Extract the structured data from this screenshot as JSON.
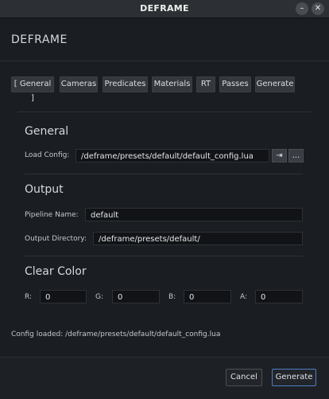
{
  "window": {
    "title": "DEFRAME",
    "minimize_glyph": "–",
    "close_glyph": "✕"
  },
  "app": {
    "title": "DEFRAME"
  },
  "tabs": [
    {
      "label": "[ General ]"
    },
    {
      "label": "Cameras"
    },
    {
      "label": "Predicates"
    },
    {
      "label": "Materials"
    },
    {
      "label": "RT"
    },
    {
      "label": "Passes"
    },
    {
      "label": "Generate"
    }
  ],
  "general": {
    "heading": "General",
    "load_config_label": "Load Config:",
    "load_config_value": "/deframe/presets/default/default_config.lua",
    "load_button_glyph": "⇥",
    "browse_button_label": "..."
  },
  "output": {
    "heading": "Output",
    "pipeline_name_label": "Pipeline Name:",
    "pipeline_name_value": "default",
    "output_dir_label": "Output Directory:",
    "output_dir_value": "/deframe/presets/default/"
  },
  "clear_color": {
    "heading": "Clear Color",
    "r_label": "R:",
    "r_value": "0",
    "g_label": "G:",
    "g_value": "0",
    "b_label": "B:",
    "b_value": "0",
    "a_label": "A:",
    "a_value": "0"
  },
  "status": {
    "text": "Config loaded: /deframe/presets/default/default_config.lua"
  },
  "footer": {
    "cancel_label": "Cancel",
    "generate_label": "Generate"
  },
  "colors": {
    "background": "#1a1d21",
    "field": "#111316",
    "accent": "#4f7fc2"
  }
}
